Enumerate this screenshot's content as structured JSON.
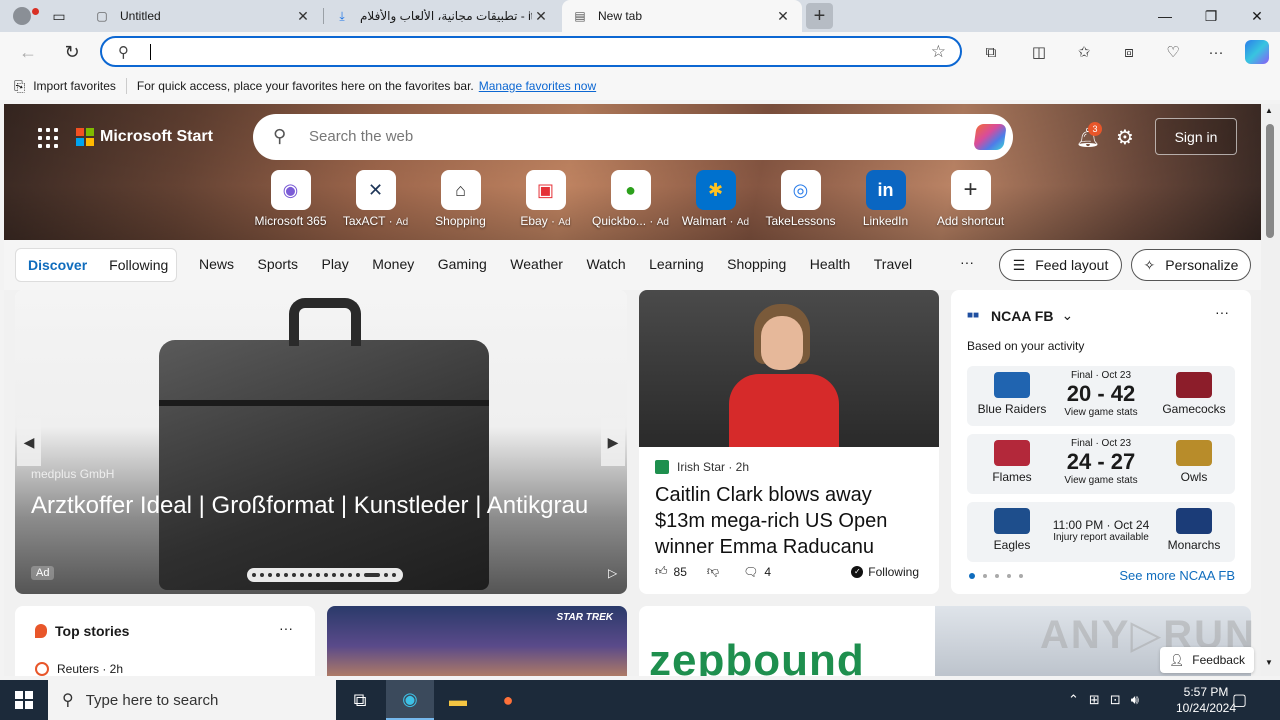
{
  "browser": {
    "tabs": [
      {
        "title": "Untitled",
        "icon": "page-icon"
      },
      {
        "title": "تطبيقات مجانية، الألعاب والأفلام - it",
        "icon": "download-icon"
      },
      {
        "title": "New tab",
        "icon": "newtab-icon",
        "active": true
      }
    ],
    "address": {
      "value": "",
      "placeholder": ""
    },
    "favorites_bar": {
      "import_label": "Import favorites",
      "hint": "For quick access, place your favorites here on the favorites bar.",
      "manage_link": "Manage favorites now"
    }
  },
  "msn": {
    "brand": "Microsoft Start",
    "search_placeholder": "Search the web",
    "notifications_count": "3",
    "signin_label": "Sign in",
    "shortcuts": [
      {
        "label": "Microsoft 365",
        "ad": ""
      },
      {
        "label": "TaxACT",
        "ad": "Ad"
      },
      {
        "label": "Shopping",
        "ad": ""
      },
      {
        "label": "Ebay",
        "ad": "Ad"
      },
      {
        "label": "Quickbo...",
        "ad": "Ad"
      },
      {
        "label": "Walmart",
        "ad": "Ad"
      },
      {
        "label": "TakeLessons",
        "ad": ""
      },
      {
        "label": "LinkedIn",
        "ad": ""
      },
      {
        "label": "Add shortcut",
        "ad": ""
      }
    ],
    "feed_tabs": {
      "discover": "Discover",
      "following": "Following"
    },
    "categories": [
      "News",
      "Sports",
      "Play",
      "Money",
      "Gaming",
      "Weather",
      "Watch",
      "Learning",
      "Shopping",
      "Health",
      "Travel"
    ],
    "more_label": "···",
    "feed_layout_label": "Feed layout",
    "personalize_label": "Personalize",
    "ad_card": {
      "source": "medplus GmbH",
      "title": "Arztkoffer Ideal | Großformat | Kunstleder | Antikgrau",
      "ad_tag": "Ad"
    },
    "news_card": {
      "source": "Irish Star · 2h",
      "headline": "Caitlin Clark blows away $13m mega-rich US Open winner Emma Raducanu",
      "likes": "85",
      "comments": "4",
      "following_label": "Following"
    },
    "ncaa": {
      "title": "NCAA FB",
      "subtitle": "Based on your activity",
      "games": [
        {
          "status": "Final · Oct 23",
          "home": "Blue Raiders",
          "away": "Gamecocks",
          "score": "20 - 42",
          "link": "View game stats"
        },
        {
          "status": "Final · Oct 23",
          "home": "Flames",
          "away": "Owls",
          "score": "24 - 27",
          "link": "View game stats"
        },
        {
          "status": "",
          "home": "Eagles",
          "away": "Monarchs",
          "score": "",
          "time": "11:00 PM · Oct 24",
          "link": "Injury report available"
        }
      ],
      "see_more": "See more NCAA FB"
    },
    "top_stories": {
      "title": "Top stories",
      "first_source": "Reuters · 2h"
    },
    "star_trek_caption": "STAR TREK",
    "zepbound_text": "zepbound",
    "feedback_label": "Feedback"
  },
  "taskbar": {
    "search_placeholder": "Type here to search",
    "time": "5:57 PM",
    "date": "10/24/2024"
  }
}
